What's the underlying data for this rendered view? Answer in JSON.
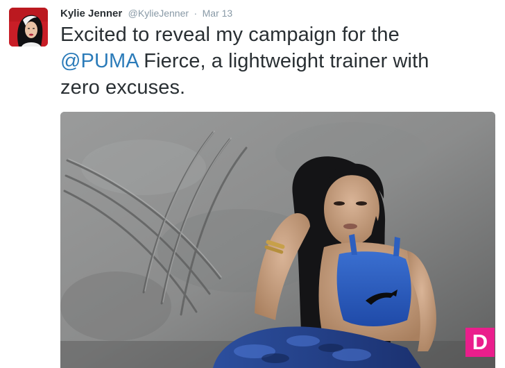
{
  "tweet": {
    "user": {
      "name": "Kylie Jenner",
      "handle": "@KylieJenner"
    },
    "separator": "·",
    "date": "Mar 13",
    "text": {
      "line1": "Excited to reveal my campaign for the",
      "mention": "@PUMA",
      "line2_rest": " Fierce, a lightweight trainer with",
      "line3": "zero excuses."
    },
    "media": {
      "watermark": "D",
      "watermark_color": "#ea1e8c"
    }
  },
  "colors": {
    "text": "#292f33",
    "muted": "#8899a6",
    "link": "#2b7bb9"
  }
}
